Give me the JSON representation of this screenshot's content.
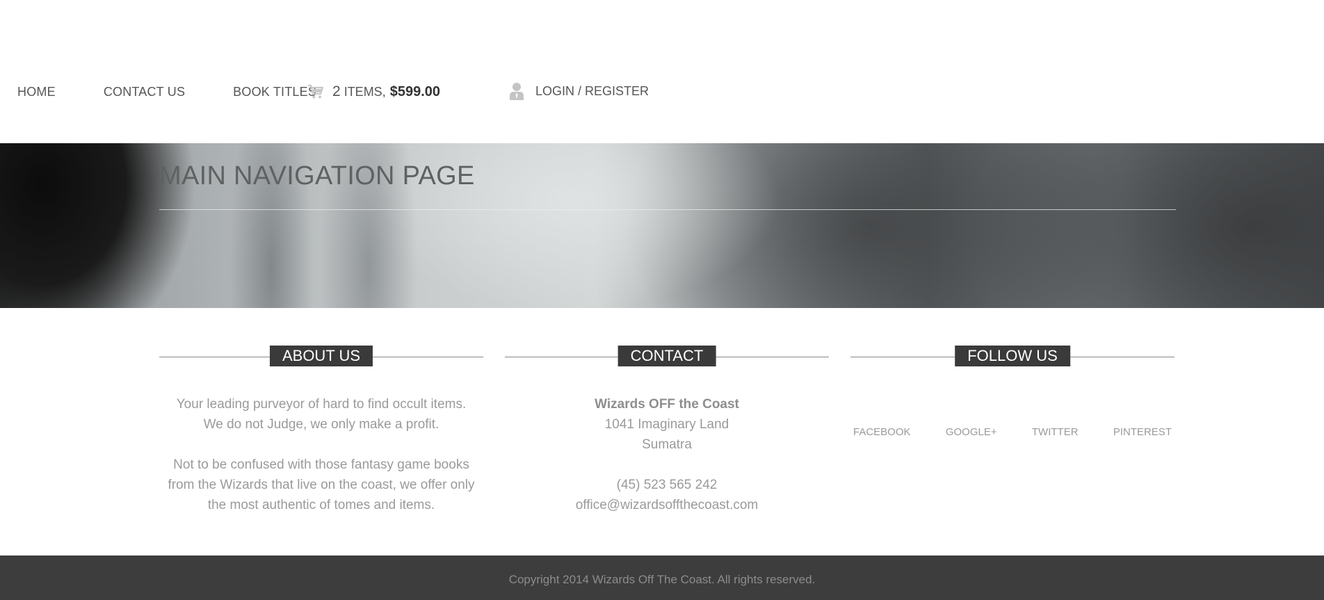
{
  "nav": {
    "items": [
      {
        "label": "HOME"
      },
      {
        "label": "CONTACT US"
      },
      {
        "label": "BOOK TITLES"
      }
    ]
  },
  "cart": {
    "icon": "shopping-cart-icon",
    "count": "2",
    "items_label": "ITEMS,",
    "total": "$599.00"
  },
  "account": {
    "icon": "user-icon",
    "label": "LOGIN / REGISTER"
  },
  "hero": {
    "title": "MAIN NAVIGATION PAGE"
  },
  "about": {
    "heading": "ABOUT US",
    "lines": [
      "Your leading purveyor of hard to find occult items.",
      "We do not Judge, we only make a profit.",
      "Not to be confused with those fantasy game books",
      "from the Wizards that live on the coast, we offer only",
      "the most authentic of tomes and items."
    ]
  },
  "contact": {
    "heading": "CONTACT",
    "company": "Wizards OFF the Coast",
    "address_line1": "1041 Imaginary Land",
    "address_line2": "Sumatra",
    "phone": "(45) 523 565 242",
    "email": "office@wizardsoffthecoast.com"
  },
  "follow": {
    "heading": "FOLLOW US",
    "links": [
      {
        "label": "FACEBOOK"
      },
      {
        "label": "GOOGLE+"
      },
      {
        "label": "TWITTER"
      },
      {
        "label": "PINTEREST"
      }
    ]
  },
  "footer": {
    "copyright": "Copyright 2014 Wizards Off The Coast. All rights reserved."
  },
  "colors": {
    "footer_bg": "#3d3d3d",
    "heading_bg": "#3a3a3a",
    "text_muted": "#9a9a9a"
  }
}
